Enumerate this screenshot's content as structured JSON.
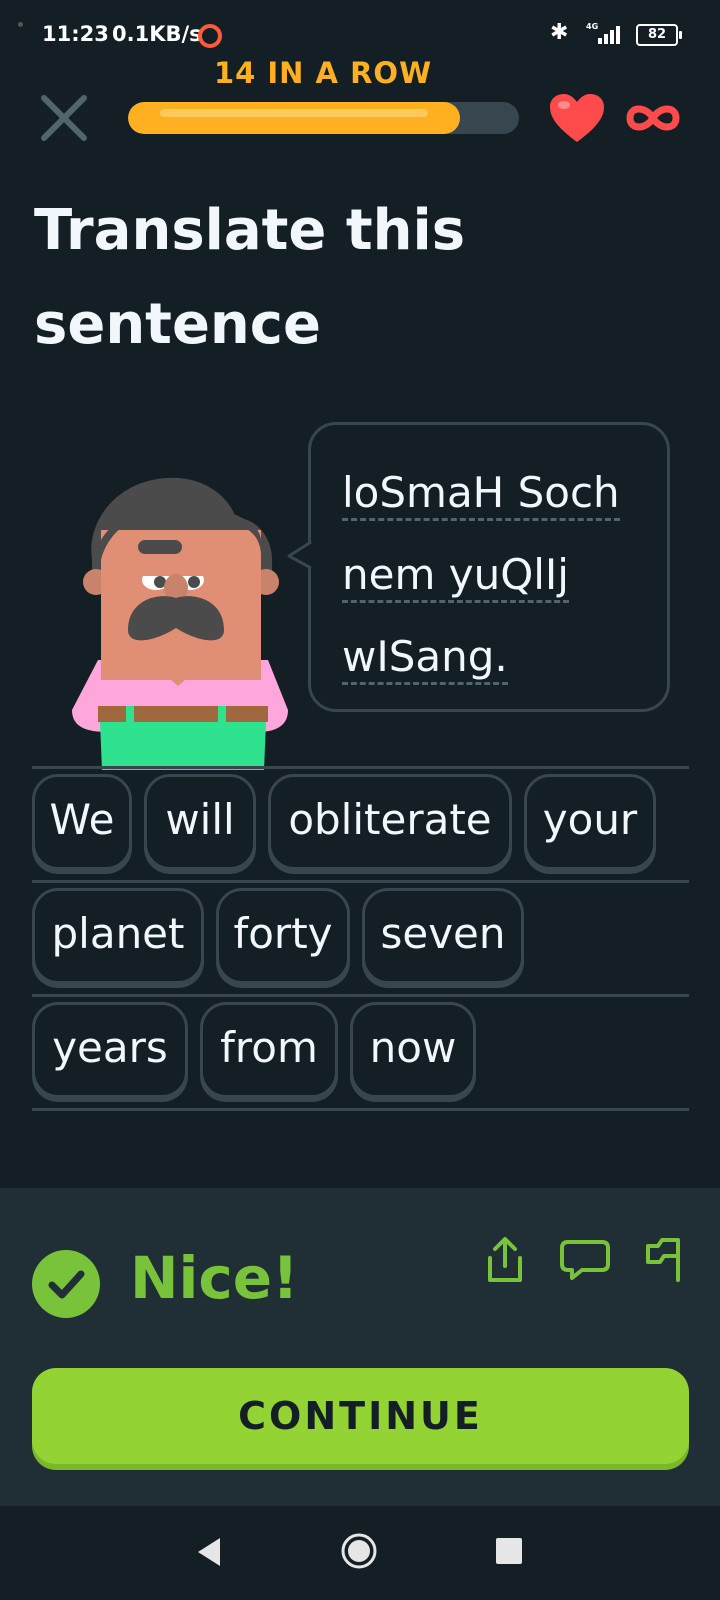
{
  "status_bar": {
    "time": "11:23",
    "network_speed": "0.1KB/s",
    "battery": "82",
    "icons": [
      "bluetooth-icon",
      "4g-signal-icon",
      "battery-icon"
    ]
  },
  "header": {
    "streak_text": "14 IN A ROW",
    "progress_fraction": 0.85,
    "close_icon": "close-icon",
    "hearts_icon": "heart-icon",
    "hearts_value": "∞"
  },
  "exercise": {
    "title": "Translate this sentence",
    "prompt_lines": [
      "loSmaH Soch",
      "nem yuQlIj",
      "wISang."
    ]
  },
  "word_bank": {
    "rows": [
      [
        "We",
        "will",
        "obliterate",
        "your"
      ],
      [
        "planet",
        "forty",
        "seven"
      ],
      [
        "years",
        "from",
        "now"
      ]
    ]
  },
  "feedback": {
    "message": "Nice!",
    "icons": [
      "check-icon",
      "share-icon",
      "comment-icon",
      "flag-icon"
    ],
    "continue_label": "CONTINUE"
  },
  "colors": {
    "background": "#131f24",
    "streak": "#ffb020",
    "heart": "#ff4b4b",
    "success": "#79c33a",
    "button": "#93d333",
    "border": "#37464f"
  },
  "nav_bar": {
    "icons": [
      "back-triangle-icon",
      "home-circle-icon",
      "recents-square-icon"
    ]
  }
}
